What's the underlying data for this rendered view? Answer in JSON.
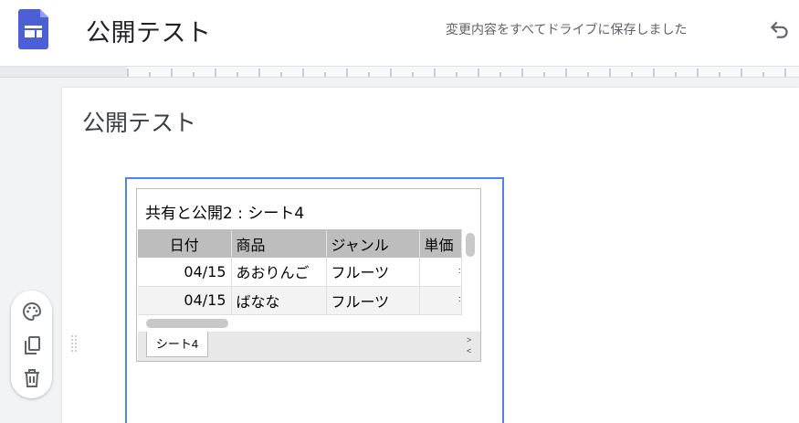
{
  "header": {
    "doc_title": "公開テスト",
    "save_status": "変更内容をすべてドライブに保存しました",
    "logo_icon": "google-sites-icon",
    "undo_icon": "undo-icon"
  },
  "page": {
    "heading": "公開テスト"
  },
  "tools": {
    "items": [
      "palette-icon",
      "copy-icon",
      "trash-icon"
    ]
  },
  "embed": {
    "sheet_title": "共有と公開2 : シート4",
    "columns": [
      "日付",
      "商品",
      "ジャンル",
      "単価"
    ],
    "rows": [
      [
        "04/15",
        "あおりんご",
        "フルーツ",
        ":"
      ],
      [
        "04/15",
        "ばなな",
        "フルーツ",
        ":"
      ]
    ],
    "sheet_tab": "シート4",
    "nav_next": ">",
    "nav_prev": "<"
  },
  "colors": {
    "accent_frame": "#4a86e8",
    "logo_blue": "#4285f4",
    "header_gray": "#bdbdbd"
  }
}
